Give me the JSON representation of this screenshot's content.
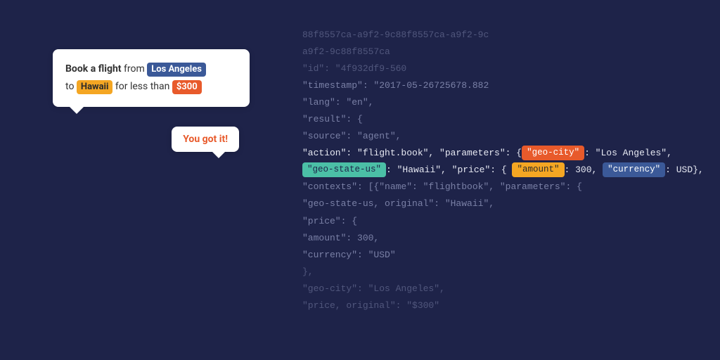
{
  "chat": {
    "user": {
      "t1": "Book a flight",
      "t2": " from ",
      "city": "Los Angeles",
      "t3": "to ",
      "state": "Hawaii",
      "t4": " for less than ",
      "price": "$300"
    },
    "reply": "You got it!"
  },
  "code": {
    "l1": "88f8557ca-a9f2-9c88f8557ca-a9f2-9c",
    "l2": "a9f2-9c88f8557ca",
    "l3": "\"id\": \"4f932df9-560",
    "l4": "\"timestamp\": \"2017-05-26725678.882",
    "l5": "\"lang\": \"en\",",
    "l6": "\"result\": {",
    "l7": "\"source\": \"agent\",",
    "l8a": "\"action\": \"flight.book\", \"parameters\": {",
    "l8_tag": "\"geo-city\"",
    "l8b": ": \"Los Angeles\",",
    "l9_tag1": "\"geo-state-us\"",
    "l9a": ": \"Hawaii\", \"price\": {",
    "l9_tag2": "\"amount\"",
    "l9b": ": 300, ",
    "l9_tag3": "\"currency\"",
    "l9c": ": USD},",
    "l10": "\"contexts\": [{\"name\": \"flightbook\", \"parameters\": {",
    "l11": "\"geo-state-us, original\": \"Hawaii\",",
    "l12": "\"price\": {",
    "l13": "\"amount\": 300,",
    "l14": "\"currency\": \"USD\"",
    "l15": "},",
    "l16": "\"geo-city\": \"Los Angeles\",",
    "l17": "\"price, original\": \"$300\""
  }
}
